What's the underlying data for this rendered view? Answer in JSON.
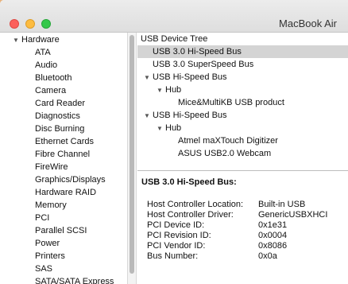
{
  "window": {
    "title": "MacBook Air"
  },
  "sidebar": {
    "section": "Hardware",
    "items": [
      "ATA",
      "Audio",
      "Bluetooth",
      "Camera",
      "Card Reader",
      "Diagnostics",
      "Disc Burning",
      "Ethernet Cards",
      "Fibre Channel",
      "FireWire",
      "Graphics/Displays",
      "Hardware RAID",
      "Memory",
      "PCI",
      "Parallel SCSI",
      "Power",
      "Printers",
      "SAS",
      "SATA/SATA Express"
    ]
  },
  "tree": {
    "header": "USB Device Tree",
    "rows": [
      {
        "label": "USB 3.0 Hi-Speed Bus",
        "selected": true
      },
      {
        "label": "USB 3.0 SuperSpeed Bus"
      },
      {
        "label": "USB Hi-Speed Bus"
      },
      {
        "label": "Hub"
      },
      {
        "label": "Mice&MultiKB USB product"
      },
      {
        "label": "USB Hi-Speed Bus"
      },
      {
        "label": "Hub"
      },
      {
        "label": "Atmel maXTouch Digitizer"
      },
      {
        "label": "ASUS USB2.0 Webcam"
      }
    ]
  },
  "detail": {
    "title": "USB 3.0 Hi-Speed Bus:",
    "properties": [
      {
        "label": "Host Controller Location:",
        "value": "Built-in USB"
      },
      {
        "label": "Host Controller Driver:",
        "value": "GenericUSBXHCI"
      },
      {
        "label": "PCI Device ID:",
        "value": "0x1e31"
      },
      {
        "label": "PCI Revision ID:",
        "value": "0x0004"
      },
      {
        "label": "PCI Vendor ID:",
        "value": "0x8086"
      },
      {
        "label": "Bus Number:",
        "value": "0x0a"
      }
    ]
  }
}
